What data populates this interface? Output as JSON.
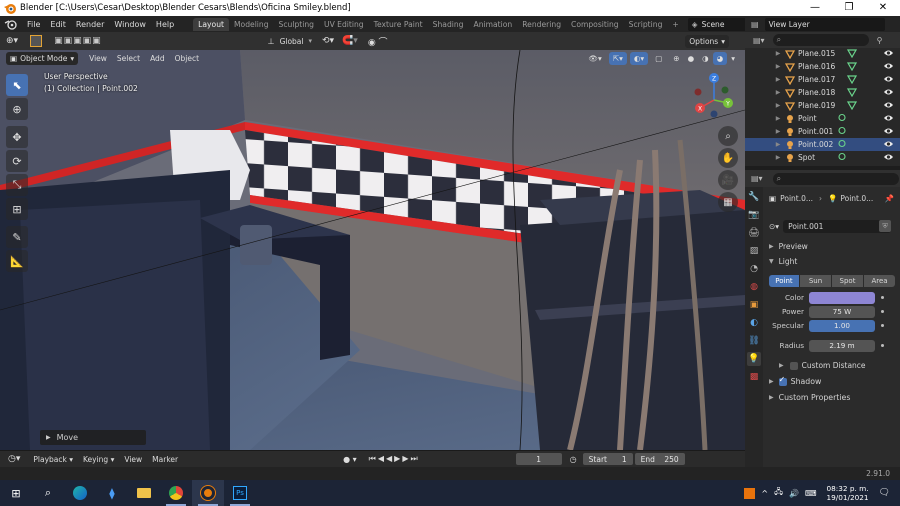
{
  "window": {
    "title": "Blender [C:\\Users\\Cesar\\Desktop\\Blender Cesars\\Blends\\Oficina Smiley.blend]",
    "minimize": "—",
    "maximize": "❐",
    "close": "✕"
  },
  "menu": [
    "File",
    "Edit",
    "Render",
    "Window",
    "Help"
  ],
  "workspaces": [
    {
      "label": "Layout",
      "active": true
    },
    {
      "label": "Modeling",
      "active": false
    },
    {
      "label": "Sculpting",
      "active": false
    },
    {
      "label": "UV Editing",
      "active": false
    },
    {
      "label": "Texture Paint",
      "active": false
    },
    {
      "label": "Shading",
      "active": false
    },
    {
      "label": "Animation",
      "active": false
    },
    {
      "label": "Rendering",
      "active": false
    },
    {
      "label": "Compositing",
      "active": false
    },
    {
      "label": "Scripting",
      "active": false
    }
  ],
  "add_workspace": "+",
  "scene": {
    "label": "Scene"
  },
  "view_layer": {
    "label": "View Layer"
  },
  "header": {
    "transform_orientation": "Global",
    "options": "Options"
  },
  "viewport_header": {
    "mode": "Object Mode",
    "menus": [
      "View",
      "Select",
      "Add",
      "Object"
    ]
  },
  "viewport": {
    "perspective": "User Perspective",
    "collection_info": "(1) Collection | Point.002",
    "move_panel": "Move"
  },
  "gizmo": {
    "x": "X",
    "y": "Y",
    "z": "Z"
  },
  "outliner": {
    "rows": [
      {
        "name": "Plane.015",
        "type": "mesh",
        "selected": false
      },
      {
        "name": "Plane.016",
        "type": "mesh",
        "selected": false
      },
      {
        "name": "Plane.017",
        "type": "mesh",
        "selected": false
      },
      {
        "name": "Plane.018",
        "type": "mesh",
        "selected": false
      },
      {
        "name": "Plane.019",
        "type": "mesh",
        "selected": false
      },
      {
        "name": "Point",
        "type": "light",
        "selected": false
      },
      {
        "name": "Point.001",
        "type": "light",
        "selected": false
      },
      {
        "name": "Point.002",
        "type": "light",
        "selected": true
      },
      {
        "name": "Spot",
        "type": "light",
        "selected": false
      }
    ]
  },
  "properties": {
    "crumb_object": "Point.0...",
    "crumb_data": "Point.0...",
    "datablock": "Point.001",
    "panels": {
      "preview": "Preview",
      "light": "Light",
      "custom_distance": "Custom Distance",
      "shadow": "Shadow",
      "custom_properties": "Custom Properties"
    },
    "light_types": [
      {
        "label": "Point",
        "active": true
      },
      {
        "label": "Sun",
        "active": false
      },
      {
        "label": "Spot",
        "active": false
      },
      {
        "label": "Area",
        "active": false
      }
    ],
    "fields": {
      "color_label": "Color",
      "color_value": "#8e86d4",
      "power_label": "Power",
      "power_value": "75 W",
      "specular_label": "Specular",
      "specular_value": "1.00",
      "radius_label": "Radius",
      "radius_value": "2.19 m"
    },
    "shadow_checked": true,
    "custom_distance_checked": false
  },
  "timeline": {
    "menus": [
      "Playback",
      "Keying",
      "View",
      "Marker"
    ],
    "current_frame": "1",
    "start_label": "Start",
    "start_value": "1",
    "end_label": "End",
    "end_value": "250"
  },
  "status": {
    "version": "2.91.0"
  },
  "taskbar": {
    "time": "08:32 p. m.",
    "date": "19/01/2021"
  },
  "colors": {
    "accent": "#4772b3",
    "selected_row": "#334d80",
    "red_trim": "#e02a2a",
    "light_icon": "#e7a34b",
    "mesh_icon": "#e7a34b",
    "data_icon": "#6ad38b"
  }
}
